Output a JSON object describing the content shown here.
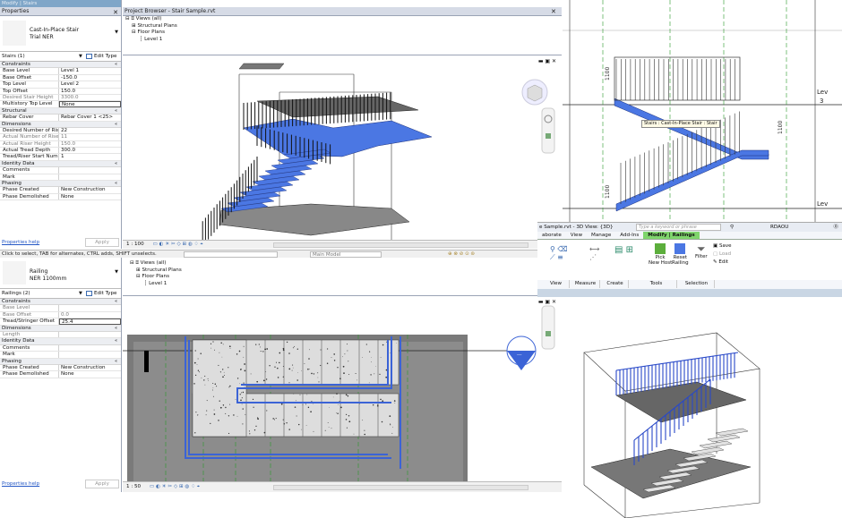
{
  "app": {
    "title": "Modify | Stairs"
  },
  "top_props": {
    "header": "Properties",
    "type_line1": "Cast-In-Place Stair",
    "type_line2": "Trial NER",
    "selector": "Stairs (1)",
    "edit_type": "Edit Type",
    "groups": [
      {
        "name": "Constraints",
        "rows": [
          {
            "k": "Base Level",
            "v": "Level 1",
            "gray": false
          },
          {
            "k": "Base Offset",
            "v": "-150.0",
            "gray": false
          },
          {
            "k": "Top Level",
            "v": "Level 2",
            "gray": false
          },
          {
            "k": "Top Offset",
            "v": "150.0",
            "gray": false
          },
          {
            "k": "Desired Stair Height",
            "v": "3300.0",
            "gray": true
          },
          {
            "k": "Multistory Top Level",
            "v": "None",
            "gray": false,
            "hl": true
          }
        ]
      },
      {
        "name": "Structural",
        "rows": [
          {
            "k": "Rebar Cover",
            "v": "Rebar Cover 1 <25>",
            "gray": false
          }
        ]
      },
      {
        "name": "Dimensions",
        "rows": [
          {
            "k": "Desired Number of Risers",
            "v": "22",
            "gray": false
          },
          {
            "k": "Actual Number of Risers",
            "v": "11",
            "gray": true
          },
          {
            "k": "Actual Riser Height",
            "v": "150.0",
            "gray": true
          },
          {
            "k": "Actual Tread Depth",
            "v": "300.0",
            "gray": false
          },
          {
            "k": "Tread/Riser Start Number",
            "v": "1",
            "gray": false
          }
        ]
      },
      {
        "name": "Identity Data",
        "rows": [
          {
            "k": "Comments",
            "v": "",
            "gray": false
          },
          {
            "k": "Mark",
            "v": "",
            "gray": false
          }
        ]
      },
      {
        "name": "Phasing",
        "rows": [
          {
            "k": "Phase Created",
            "v": "New Construction",
            "gray": false
          },
          {
            "k": "Phase Demolished",
            "v": "None",
            "gray": false
          }
        ]
      }
    ],
    "help": "Properties help",
    "apply": "Apply"
  },
  "bottom_props": {
    "type_line1": "Railing",
    "type_line2": "NER 1100mm",
    "selector": "Railings (2)",
    "edit_type": "Edit Type",
    "groups": [
      {
        "name": "Constraints",
        "rows": [
          {
            "k": "Base Level",
            "v": "",
            "gray": true
          },
          {
            "k": "Base Offset",
            "v": "0.0",
            "gray": true
          },
          {
            "k": "Tread/Stringer Offset",
            "v": "25.4",
            "gray": false,
            "hl": true
          }
        ]
      },
      {
        "name": "Dimensions",
        "rows": [
          {
            "k": "Length",
            "v": "",
            "gray": true
          }
        ]
      },
      {
        "name": "Identity Data",
        "rows": [
          {
            "k": "Comments",
            "v": "",
            "gray": false
          },
          {
            "k": "Mark",
            "v": "",
            "gray": false
          }
        ]
      },
      {
        "name": "Phasing",
        "rows": [
          {
            "k": "Phase Created",
            "v": "New Construction",
            "gray": false
          },
          {
            "k": "Phase Demolished",
            "v": "None",
            "gray": false
          }
        ]
      }
    ],
    "help": "Properties help",
    "apply": "Apply"
  },
  "browser": {
    "header": "Project Browser - Stair Sample.rvt",
    "views": "Views (all)",
    "structural": "Structural Plans",
    "floor": "Floor Plans",
    "level": "Level 1"
  },
  "view_top": {
    "scale": "1 : 100"
  },
  "view_bottom": {
    "scale": "1 : 50"
  },
  "status": {
    "hint": "Click to select, TAB for alternates, CTRL adds, SHIFT unselects.",
    "model": "Main Model"
  },
  "elev": {
    "dim1": "1100",
    "dim2": "1100",
    "dim3": "1100",
    "level_a": "Lev",
    "level_a_num": "3",
    "level_b": "Lev",
    "tooltip": "Stairs : Cast-In-Place Stair : Stair"
  },
  "ribbon": {
    "title": "e Sample.rvt - 3D View: {3D}",
    "search_placeholder": "Type a keyword or phrase",
    "user": "RDAOU",
    "tabs": [
      "aborate",
      "View",
      "Manage",
      "Add-Ins",
      "Modify | Railings"
    ],
    "pick_new_host_1": "Pick",
    "pick_new_host_2": "New Host",
    "reset_railing_1": "Reset",
    "reset_railing_2": "Railing",
    "filter": "Filter",
    "save": "Save",
    "load": "Load",
    "edit": "Edit",
    "panels": [
      "View",
      "Measure",
      "Create",
      "Tools",
      "Selection"
    ]
  },
  "colors": {
    "accent": "#3b63d6",
    "hdr": "#d6dbe6",
    "ribbon_tab": "#7fd56c"
  }
}
